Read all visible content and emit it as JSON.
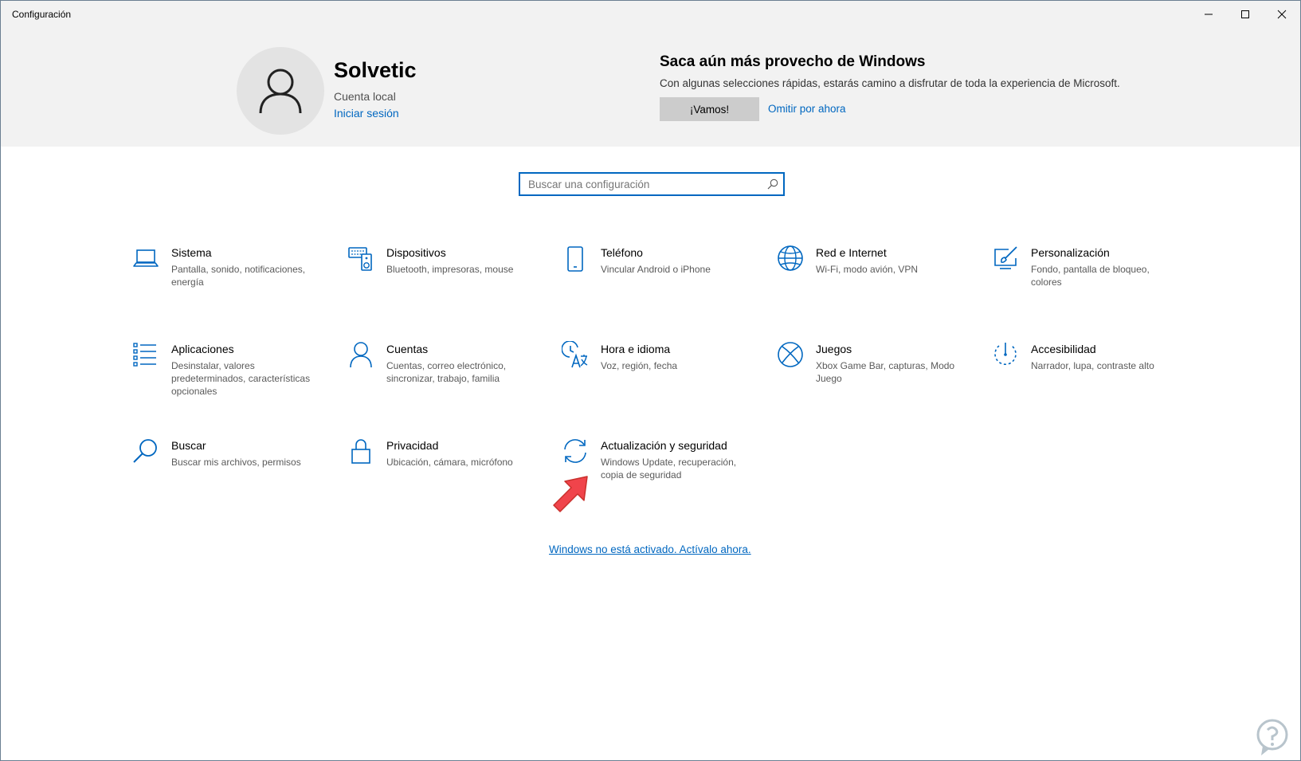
{
  "window": {
    "title": "Configuración"
  },
  "header": {
    "user_name": "Solvetic",
    "account_type": "Cuenta local",
    "signin_label": "Iniciar sesión",
    "promo_title": "Saca aún más provecho de Windows",
    "promo_desc": "Con algunas selecciones rápidas, estarás camino a disfrutar de toda la experiencia de Microsoft.",
    "promo_button": "¡Vamos!",
    "skip_label": "Omitir por ahora"
  },
  "search": {
    "placeholder": "Buscar una configuración",
    "value": ""
  },
  "tiles": [
    {
      "title": "Sistema",
      "desc": "Pantalla, sonido, notificaciones, energía",
      "icon": "laptop-icon"
    },
    {
      "title": "Dispositivos",
      "desc": "Bluetooth, impresoras, mouse",
      "icon": "devices-icon"
    },
    {
      "title": "Teléfono",
      "desc": "Vincular Android o iPhone",
      "icon": "phone-icon"
    },
    {
      "title": "Red e Internet",
      "desc": "Wi-Fi, modo avión, VPN",
      "icon": "globe-icon"
    },
    {
      "title": "Personalización",
      "desc": "Fondo, pantalla de bloqueo, colores",
      "icon": "paintbrush-icon"
    },
    {
      "title": "Aplicaciones",
      "desc": "Desinstalar, valores predeterminados, características opcionales",
      "icon": "apps-list-icon"
    },
    {
      "title": "Cuentas",
      "desc": "Cuentas, correo electrónico, sincronizar, trabajo, familia",
      "icon": "person-icon"
    },
    {
      "title": "Hora e idioma",
      "desc": "Voz, región, fecha",
      "icon": "time-language-icon"
    },
    {
      "title": "Juegos",
      "desc": "Xbox Game Bar, capturas, Modo Juego",
      "icon": "xbox-icon"
    },
    {
      "title": "Accesibilidad",
      "desc": "Narrador, lupa, contraste alto",
      "icon": "accessibility-icon"
    },
    {
      "title": "Buscar",
      "desc": "Buscar mis archivos, permisos",
      "icon": "magnifier-icon"
    },
    {
      "title": "Privacidad",
      "desc": "Ubicación, cámara, micrófono",
      "icon": "lock-icon"
    },
    {
      "title": "Actualización y seguridad",
      "desc": "Windows Update, recuperación, copia de seguridad",
      "icon": "sync-icon"
    }
  ],
  "activation_link": "Windows no está activado. Actívalo ahora.",
  "colors": {
    "accent": "#0067c0",
    "header_bg": "#f2f2f2",
    "arrow": "#f0444b"
  }
}
